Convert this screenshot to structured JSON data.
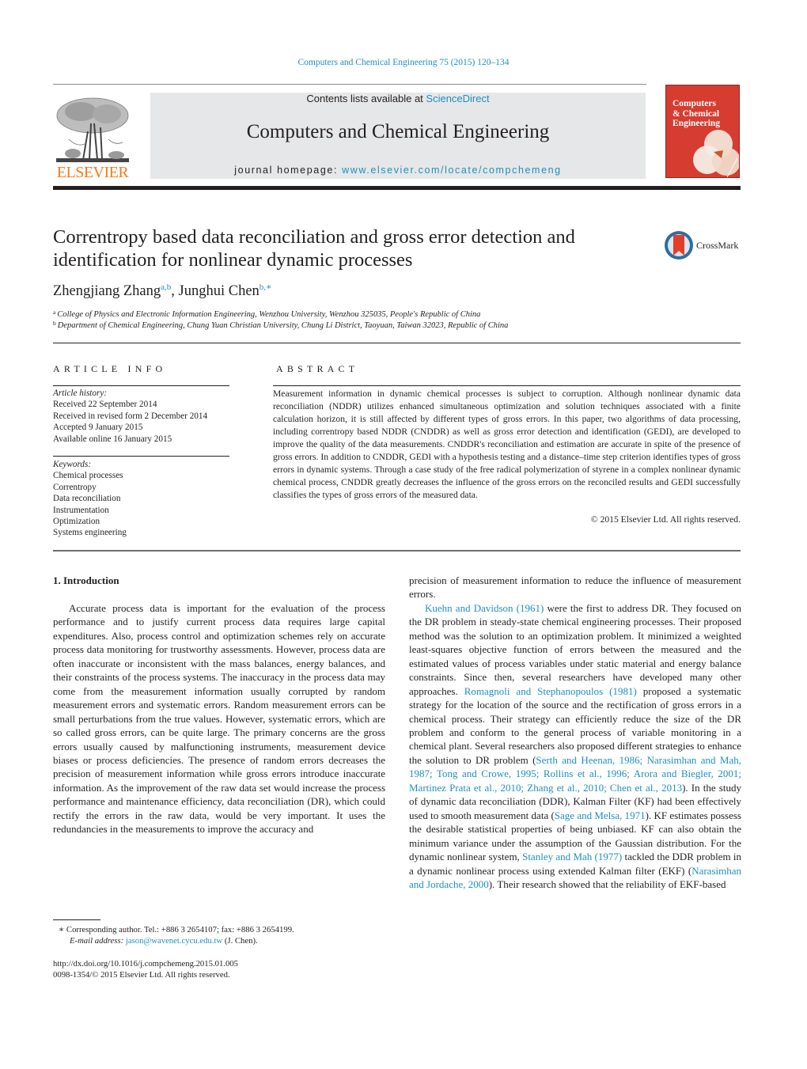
{
  "header": {
    "citation": "Computers and Chemical Engineering 75 (2015) 120–134",
    "contents_prefix": "Contents lists available at ",
    "contents_link": "ScienceDirect",
    "journal_name": "Computers and Chemical Engineering",
    "homepage_prefix": "journal homepage: ",
    "homepage_link": "www.elsevier.com/locate/compchemeng",
    "publisher_logo_text": "ELSEVIER",
    "cover_title": "Computers\n& Chemical\nEngineering",
    "publisher_color": "#f47b20",
    "link_color": "#1f8fc0",
    "cover_color": "#d63c30"
  },
  "article": {
    "title": "Correntropy based data reconciliation and gross error detection and identification for nonlinear dynamic processes",
    "crossmark_label": "CrossMark",
    "authors": [
      {
        "name": "Zhengjiang Zhang",
        "sup": "a,b"
      },
      {
        "name": "Junghui Chen",
        "sup": "b,∗"
      }
    ],
    "author_separator": ", ",
    "affiliations": [
      {
        "label": "a",
        "text": "College of Physics and Electronic Information Engineering, Wenzhou University, Wenzhou 325035, People's Republic of China"
      },
      {
        "label": "b",
        "text": "Department of Chemical Engineering, Chung Yuan Christian University, Chung Li District, Taoyuan, Taiwan 32023, Republic of China"
      }
    ]
  },
  "article_info": {
    "heading": "ARTICLE INFO",
    "history_heading": "Article history:",
    "history": [
      "Received 22 September 2014",
      "Received in revised form 2 December 2014",
      "Accepted 9 January 2015",
      "Available online 16 January 2015"
    ],
    "keywords_heading": "Keywords:",
    "keywords": [
      "Chemical processes",
      "Correntropy",
      "Data reconciliation",
      "Instrumentation",
      "Optimization",
      "Systems engineering"
    ]
  },
  "abstract": {
    "heading": "ABSTRACT",
    "text": "Measurement information in dynamic chemical processes is subject to corruption. Although nonlinear dynamic data reconciliation (NDDR) utilizes enhanced simultaneous optimization and solution techniques associated with a finite calculation horizon, it is still affected by different types of gross errors. In this paper, two algorithms of data processing, including correntropy based NDDR (CNDDR) as well as gross error detection and identification (GEDI), are developed to improve the quality of the data measurements. CNDDR's reconciliation and estimation are accurate in spite of the presence of gross errors. In addition to CNDDR, GEDI with a hypothesis testing and a distance–time step criterion identifies types of gross errors in dynamic systems. Through a case study of the free radical polymerization of styrene in a complex nonlinear dynamic chemical process, CNDDR greatly decreases the influence of the gross errors on the reconciled results and GEDI successfully classifies the types of gross errors of the measured data.",
    "copyright": "© 2015 Elsevier Ltd. All rights reserved."
  },
  "body": {
    "section_heading": "1.  Introduction",
    "left_paragraph": "Accurate process data is important for the evaluation of the process performance and to justify current process data requires large capital expenditures. Also, process control and optimization schemes rely on accurate process data monitoring for trustworthy assessments. However, process data are often inaccurate or inconsistent with the mass balances, energy balances, and their constraints of the process systems. The inaccuracy in the process data may come from the measurement information usually corrupted by random measurement errors and systematic errors. Random measurement errors can be small perturbations from the true values. However, systematic errors, which are so called gross errors, can be quite large. The primary concerns are the gross errors usually caused by malfunctioning instruments, measurement device biases or process deficiencies. The presence of random errors decreases the precision of measurement information while gross errors introduce inaccurate information. As the improvement of the raw data set would increase the process performance and maintenance efficiency, data reconciliation (DR), which could rectify the errors in the raw data, would be very important. It uses the redundancies in the measurements to improve the accuracy and",
    "right_continuation": "precision of measurement information to reduce the influence of measurement errors.",
    "right_paragraph": {
      "ref1": "Kuehn and Davidson (1961)",
      "t1": " were the first to address DR. They focused on the DR problem in steady-state chemical engineering processes. Their proposed method was the solution to an optimization problem. It minimized a weighted least-squares objective function of errors between the measured and the estimated values of process variables under static material and energy balance constraints. Since then, several researchers have developed many other approaches. ",
      "ref2": "Romagnoli and Stephanopoulos (1981)",
      "t2": " proposed a systematic strategy for the location of the source and the rectification of gross errors in a chemical process. Their strategy can efficiently reduce the size of the DR problem and conform to the general process of variable monitoring in a chemical plant. Several researchers also proposed different strategies to enhance the solution to DR problem (",
      "ref3": "Serth and Heenan, 1986; Narasimhan and Mah, 1987; Tong and Crowe, 1995; Rollins et al., 1996; Arora and Biegler, 2001; Martinez Prata et al., 2010; Zhang et al., 2010; Chen et al., 2013",
      "t3": "). In the study of dynamic data reconciliation (DDR), Kalman Filter (KF) had been effectively used to smooth measurement data (",
      "ref4": "Sage and Melsa, 1971",
      "t4": "). KF estimates possess the desirable statistical properties of being unbiased. KF can also obtain the minimum variance under the assumption of the Gaussian distribution. For the dynamic nonlinear system, ",
      "ref5": "Stanley and Mah (1977)",
      "t5": " tackled the DDR problem in a dynamic nonlinear process using extended Kalman filter (EKF) (",
      "ref6": "Narasimhan and Jordache, 2000",
      "t6": "). Their research showed that the reliability of EKF-based"
    }
  },
  "footer": {
    "corresponding": "∗  Corresponding author. Tel.: +886 3 2654107; fax: +886 3 2654199.",
    "email_label": "E-mail address: ",
    "email": "jason@wavenet.cycu.edu.tw",
    "email_suffix": " (J. Chen).",
    "doi": "http://dx.doi.org/10.1016/j.compchemeng.2015.01.005",
    "issn": "0098-1354/© 2015 Elsevier Ltd. All rights reserved."
  }
}
